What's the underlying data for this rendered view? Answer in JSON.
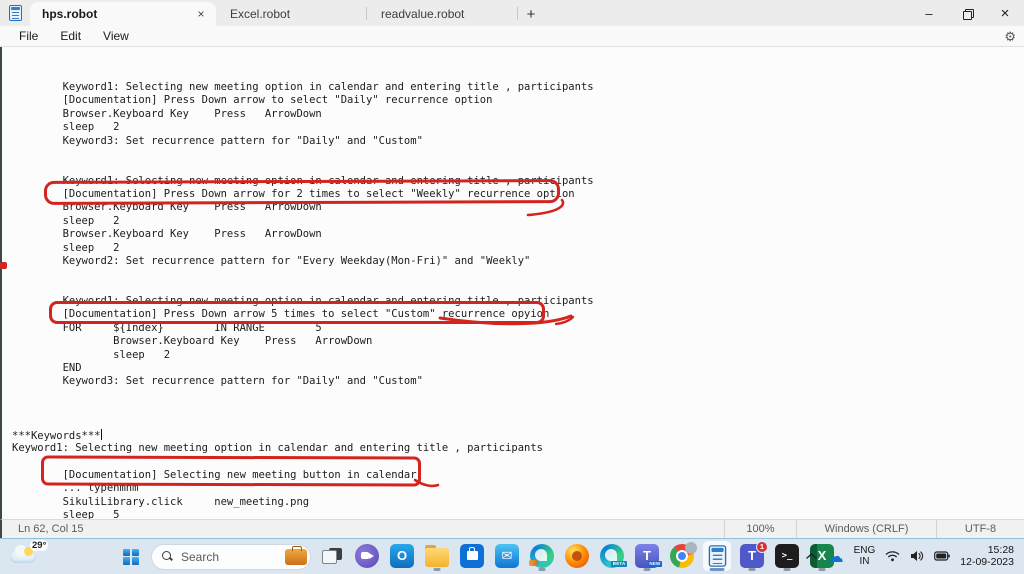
{
  "titlebar": {
    "tabs": [
      {
        "label": "hps.robot",
        "active": true
      },
      {
        "label": "Excel.robot",
        "active": false
      },
      {
        "label": "readvalue.robot",
        "active": false
      }
    ],
    "close_tab_glyph": "×",
    "new_tab_glyph": "+",
    "controls": {
      "minimize": "–",
      "close": "×"
    }
  },
  "menubar": {
    "items": [
      "File",
      "Edit",
      "View"
    ],
    "settings_glyph": "⚙"
  },
  "editor": {
    "lines": [
      {
        "text": "        Keyword1: Selecting new meeting option in calendar and entering title , participants"
      },
      {
        "text": "        [Documentation] Press Down arrow to select \"Daily\" recurrence option"
      },
      {
        "text": "        Browser.Keyboard Key    Press   ArrowDown"
      },
      {
        "text": "        sleep   2"
      },
      {
        "text": "        Keyword3: Set recurrence pattern for \"Daily\" and \"Custom\""
      },
      {
        "text": ""
      },
      {
        "text": ""
      },
      {
        "text": "        Keyword1: Selecting new meeting option in calendar and entering title , participants"
      },
      {
        "text": "        [Documentation] Press Down arrow for 2 times to select \"Weekly\" recurrence option"
      },
      {
        "text": "        Browser.Keyboard Key    Press   ArrowDown"
      },
      {
        "text": "        sleep   2"
      },
      {
        "text": "        Browser.Keyboard Key    Press   ArrowDown"
      },
      {
        "text": "        sleep   2"
      },
      {
        "text": "        Keyword2: Set recurrence pattern for \"Every Weekday(Mon-Fri)\" and \"Weekly\""
      },
      {
        "text": ""
      },
      {
        "text": ""
      },
      {
        "text": "        Keyword1: Selecting new meeting option in calendar and entering title , participants"
      },
      {
        "text": "        [Documentation] Press Down arrow 5 times to select \"Custom\" recurrence opyion"
      },
      {
        "text": "        FOR     ${Index}        IN RANGE        5"
      },
      {
        "text": "                Browser.Keyboard Key    Press   ArrowDown"
      },
      {
        "text": "                sleep   2"
      },
      {
        "text": "        END"
      },
      {
        "text": "        Keyword3: Set recurrence pattern for \"Daily\" and \"Custom\""
      },
      {
        "text": ""
      },
      {
        "text": ""
      },
      {
        "text": ""
      },
      {
        "text": "***Keywords***",
        "caret": true
      },
      {
        "text": "Keyword1: Selecting new meeting option in calendar and entering title , participants"
      },
      {
        "text": ""
      },
      {
        "text": "        [Documentation] Selecting new meeting button in calendar"
      },
      {
        "text": "        ... typenmnm"
      },
      {
        "text": "        SikuliLibrary.click     new_meeting.png"
      },
      {
        "text": "        sleep   5"
      }
    ]
  },
  "annotations": {
    "color": "#d3251f",
    "highlighted_lines": [
      "[Documentation] Press Down arrow for 2 times to select \"Weekly\" recurrence option",
      "[Documentation] Press Down arrow 5 times to select \"Custom\" recurrence opyion",
      "[Documentation] Selecting new meeting button in calendar"
    ]
  },
  "statusbar": {
    "position": "Ln 62, Col 15",
    "zoom": "100%",
    "line_ending": "Windows (CRLF)",
    "encoding": "UTF-8"
  },
  "taskbar": {
    "weather": {
      "temp": "29°"
    },
    "search": {
      "placeholder": "Search"
    },
    "apps": [
      {
        "name": "task-view"
      },
      {
        "name": "meet"
      },
      {
        "name": "outlook",
        "letter": "O"
      },
      {
        "name": "file-explorer",
        "running": true
      },
      {
        "name": "store"
      },
      {
        "name": "mail",
        "glyph": "✉"
      },
      {
        "name": "edge",
        "running": true
      },
      {
        "name": "firefox"
      },
      {
        "name": "edge-beta",
        "tag": "BETA"
      },
      {
        "name": "teams-new",
        "letter": "T",
        "tag": "NEW",
        "running": true
      },
      {
        "name": "chrome"
      },
      {
        "name": "notepad",
        "active": true,
        "running": true
      },
      {
        "name": "teams-classic",
        "letter": "T",
        "badge": "1",
        "running": true
      },
      {
        "name": "terminal",
        "glyph": ">_",
        "running": true
      },
      {
        "name": "excel",
        "letter": "X",
        "running": true
      }
    ],
    "tray": {
      "language_line1": "ENG",
      "language_line2": "IN",
      "time": "15:28",
      "date": "12-09-2023"
    }
  }
}
